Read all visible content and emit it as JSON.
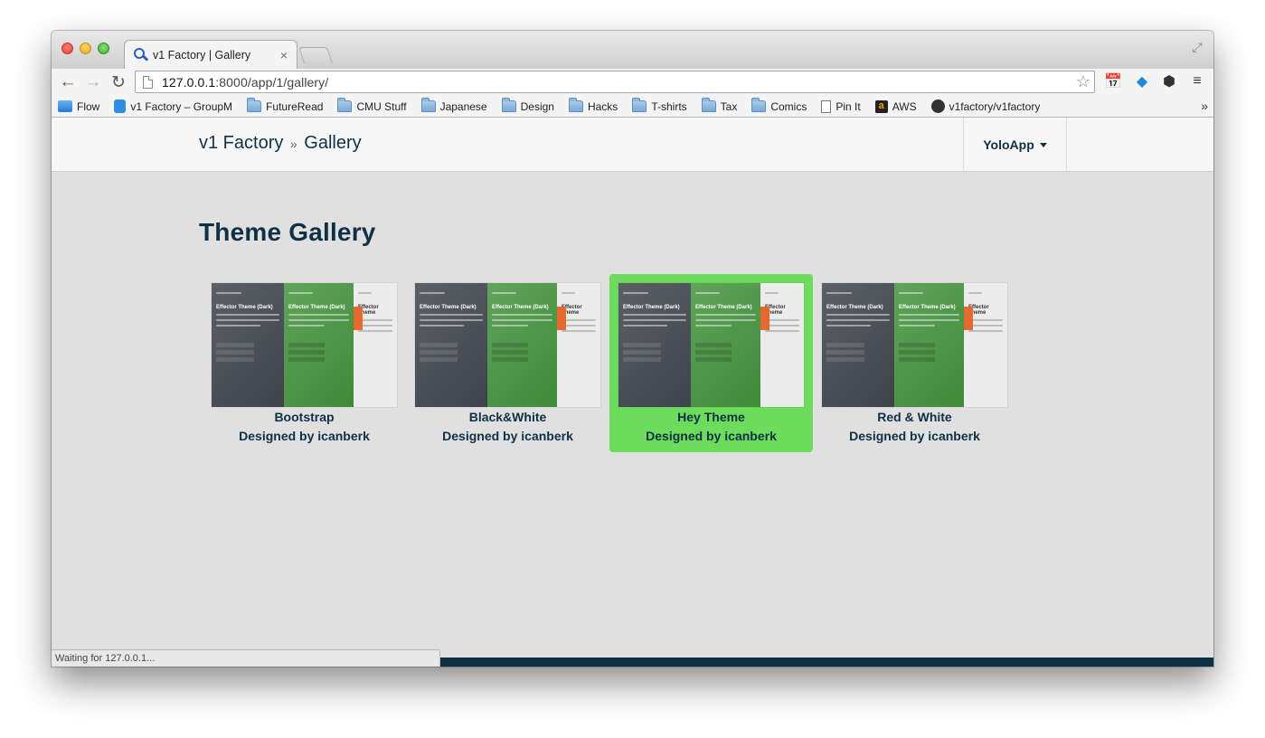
{
  "browser": {
    "tab_title": "v1 Factory | Gallery",
    "tab_close": "×",
    "url_host": "127.0.0.1",
    "url_rest": ":8000/app/1/gallery/",
    "status_text": "Waiting for 127.0.0.1..."
  },
  "bookmarks": [
    {
      "label": "Flow",
      "icon": "flow-icon"
    },
    {
      "label": "v1 Factory – GroupM",
      "icon": "groupme-icon"
    },
    {
      "label": "FutureRead",
      "icon": "folder-icon"
    },
    {
      "label": "CMU Stuff",
      "icon": "folder-icon"
    },
    {
      "label": "Japanese",
      "icon": "folder-icon"
    },
    {
      "label": "Design",
      "icon": "folder-icon"
    },
    {
      "label": "Hacks",
      "icon": "folder-icon"
    },
    {
      "label": "T-shirts",
      "icon": "folder-icon"
    },
    {
      "label": "Tax",
      "icon": "folder-icon"
    },
    {
      "label": "Comics",
      "icon": "folder-icon"
    },
    {
      "label": "Pin It",
      "icon": "document-icon"
    },
    {
      "label": "AWS",
      "icon": "amazon-icon"
    },
    {
      "label": "v1factory/v1factory",
      "icon": "github-icon"
    }
  ],
  "bookmarks_overflow": "»",
  "site": {
    "brand": "v1 Factory",
    "separator": "»",
    "section": "Gallery",
    "app_menu": "YoloApp"
  },
  "page": {
    "heading": "Theme Gallery"
  },
  "themes": [
    {
      "name": "Bootstrap",
      "author": "Designed by icanberk",
      "selected": false
    },
    {
      "name": "Black&White",
      "author": "Designed by icanberk",
      "selected": false
    },
    {
      "name": "Hey Theme",
      "author": "Designed by icanberk",
      "selected": true
    },
    {
      "name": "Red & White",
      "author": "Designed by icanberk",
      "selected": false
    }
  ],
  "thumbnail": {
    "panel_title": "Effector Theme (Dark)",
    "panel_title_short": "Effector Theme"
  },
  "colors": {
    "selected": "#6ddc5c",
    "brand_text": "#0f3145",
    "page_bg": "#e0e0e0"
  }
}
